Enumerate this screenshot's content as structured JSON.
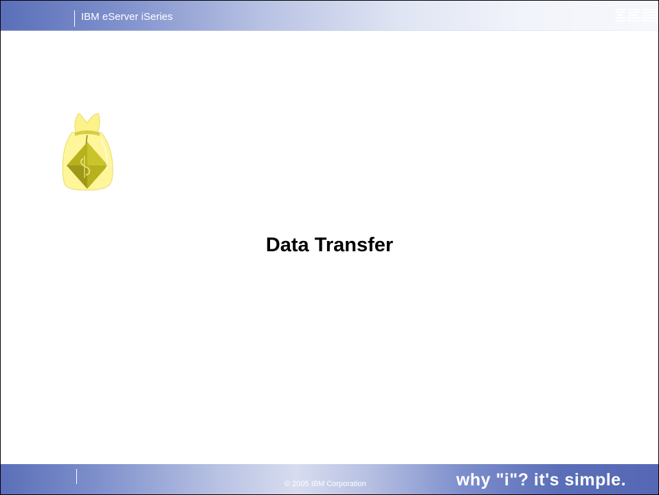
{
  "header": {
    "product_name": "IBM eServer iSeries",
    "logo_icon": "ibm-logo-icon",
    "logo_text": "IBM"
  },
  "main": {
    "illustration_icon": "money-bag-icon",
    "title": "Data Transfer"
  },
  "footer": {
    "copyright": "© 2005 IBM Corporation",
    "slogan": "why \"i\"? it's simple."
  },
  "colors": {
    "bar_dark": "#5a6fb8",
    "bar_light": "#f7f8fc",
    "bag_yellow": "#fff59a",
    "bag_diamond": "#b7b11e"
  }
}
